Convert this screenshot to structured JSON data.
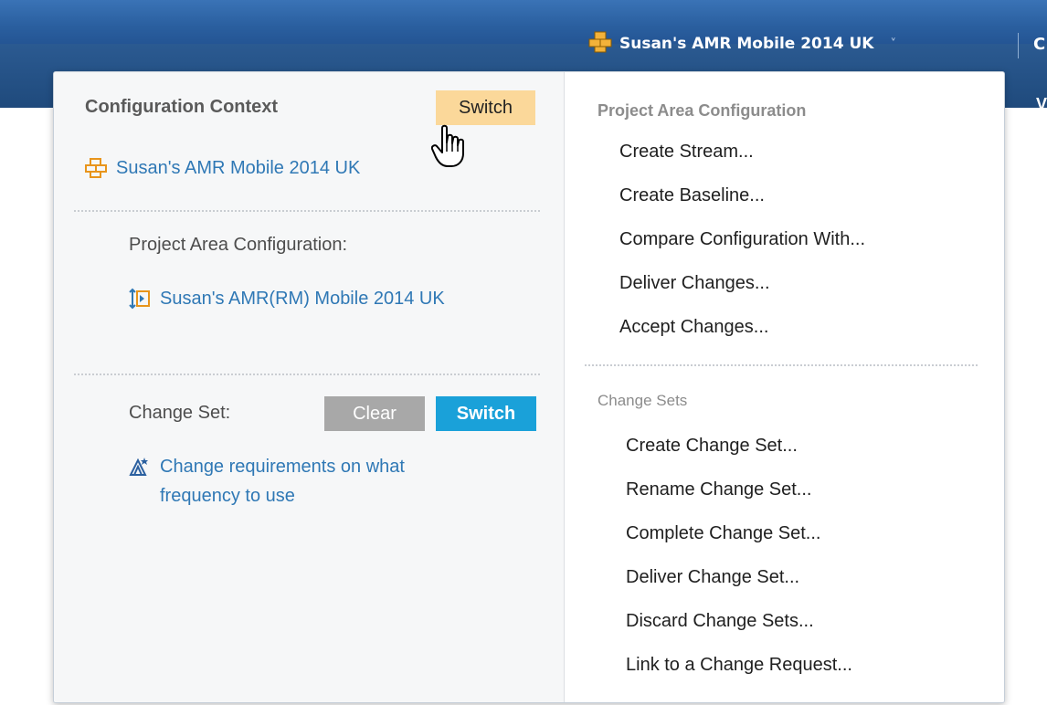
{
  "top_bar": {
    "config_name": "Susan's AMR Mobile 2014 UK",
    "chevron": "˅",
    "cut_text": "C",
    "sub_text": "V"
  },
  "left_panel": {
    "title": "Configuration Context",
    "switch_label": "Switch",
    "context_link": "Susan's AMR Mobile 2014 UK",
    "project_area_config_label": "Project Area Configuration:",
    "project_area_config_link": "Susan's AMR(RM) Mobile 2014 UK",
    "change_set_label": "Change Set:",
    "clear_label": "Clear",
    "switch_blue_label": "Switch",
    "change_set_link": "Change requirements on what frequency to use"
  },
  "right_panel": {
    "project_area_section": "Project Area Configuration",
    "project_area_items": [
      "Create Stream...",
      "Create Baseline...",
      "Compare Configuration With...",
      "Deliver Changes...",
      "Accept Changes..."
    ],
    "change_sets_section": "Change Sets",
    "change_set_items": [
      "Create Change Set...",
      "Rename Change Set...",
      "Complete Change Set...",
      "Deliver Change Set...",
      "Discard Change Sets...",
      "Link to a Change Request..."
    ]
  },
  "icons": {
    "config": "stream-config-icon",
    "pac": "component-config-icon",
    "change_set": "change-set-icon",
    "cursor": "hand-pointer-icon"
  },
  "colors": {
    "top_bar": "#2a5f9f",
    "link": "#2f78b5",
    "switch_highlight": "#fbd89a",
    "switch_blue": "#1aa1d9",
    "clear_gray": "#a8a8a8",
    "icon_orange": "#f0a020"
  }
}
